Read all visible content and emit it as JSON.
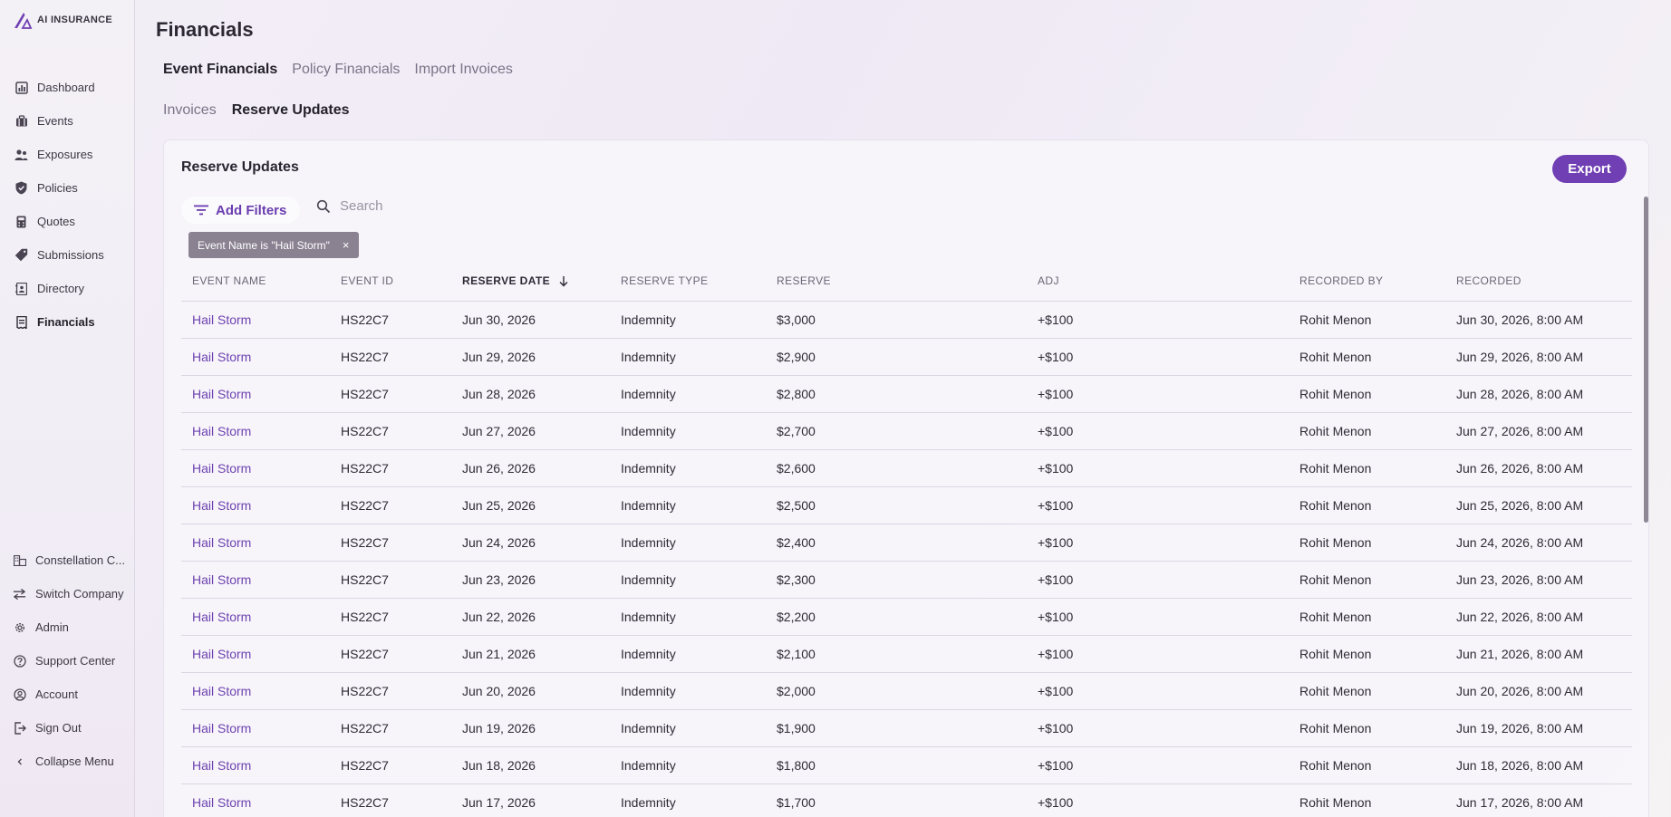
{
  "brand": {
    "name": "AI INSURANCE"
  },
  "sidebar": {
    "items": [
      {
        "label": "Dashboard",
        "icon": "dashboard-icon"
      },
      {
        "label": "Events",
        "icon": "briefcase-icon"
      },
      {
        "label": "Exposures",
        "icon": "people-icon"
      },
      {
        "label": "Policies",
        "icon": "shield-icon"
      },
      {
        "label": "Quotes",
        "icon": "calculator-icon"
      },
      {
        "label": "Submissions",
        "icon": "tag-icon"
      },
      {
        "label": "Directory",
        "icon": "contacts-book-icon"
      },
      {
        "label": "Financials",
        "icon": "receipt-icon",
        "active": true
      }
    ],
    "bottom_items": [
      {
        "label": "Constellation C...",
        "icon": "building-icon"
      },
      {
        "label": "Switch Company",
        "icon": "switch-arrows-icon"
      },
      {
        "label": "Admin",
        "icon": "gear-icon"
      },
      {
        "label": "Support Center",
        "icon": "help-circle-icon"
      },
      {
        "label": "Account",
        "icon": "account-circle-icon"
      },
      {
        "label": "Sign Out",
        "icon": "sign-out-icon"
      },
      {
        "label": "Collapse Menu",
        "icon": "chevron-left-icon"
      }
    ]
  },
  "page": {
    "title": "Financials"
  },
  "tabs_primary": [
    "Event Financials",
    "Policy Financials",
    "Import Invoices"
  ],
  "tabs_secondary": [
    "Invoices",
    "Reserve Updates"
  ],
  "card": {
    "title": "Reserve Updates",
    "export_label": "Export",
    "add_filters_label": "Add Filters",
    "search_placeholder": "Search",
    "filter_chip": "Event Name is \"Hail Storm\"",
    "filter_chip_close": "×"
  },
  "table": {
    "columns": [
      "EVENT NAME",
      "EVENT ID",
      "RESERVE DATE",
      "RESERVE TYPE",
      "RESERVE",
      "ADJ",
      "RECORDED BY",
      "RECORDED"
    ],
    "sorted_column": "RESERVE DATE",
    "rows": [
      [
        "Hail Storm",
        "HS22C7",
        "Jun 30, 2026",
        "Indemnity",
        "$3,000",
        "+$100",
        "Rohit Menon",
        "Jun 30, 2026, 8:00 AM"
      ],
      [
        "Hail Storm",
        "HS22C7",
        "Jun 29, 2026",
        "Indemnity",
        "$2,900",
        "+$100",
        "Rohit Menon",
        "Jun 29, 2026, 8:00 AM"
      ],
      [
        "Hail Storm",
        "HS22C7",
        "Jun 28, 2026",
        "Indemnity",
        "$2,800",
        "+$100",
        "Rohit Menon",
        "Jun 28, 2026, 8:00 AM"
      ],
      [
        "Hail Storm",
        "HS22C7",
        "Jun 27, 2026",
        "Indemnity",
        "$2,700",
        "+$100",
        "Rohit Menon",
        "Jun 27, 2026, 8:00 AM"
      ],
      [
        "Hail Storm",
        "HS22C7",
        "Jun 26, 2026",
        "Indemnity",
        "$2,600",
        "+$100",
        "Rohit Menon",
        "Jun 26, 2026, 8:00 AM"
      ],
      [
        "Hail Storm",
        "HS22C7",
        "Jun 25, 2026",
        "Indemnity",
        "$2,500",
        "+$100",
        "Rohit Menon",
        "Jun 25, 2026, 8:00 AM"
      ],
      [
        "Hail Storm",
        "HS22C7",
        "Jun 24, 2026",
        "Indemnity",
        "$2,400",
        "+$100",
        "Rohit Menon",
        "Jun 24, 2026, 8:00 AM"
      ],
      [
        "Hail Storm",
        "HS22C7",
        "Jun 23, 2026",
        "Indemnity",
        "$2,300",
        "+$100",
        "Rohit Menon",
        "Jun 23, 2026, 8:00 AM"
      ],
      [
        "Hail Storm",
        "HS22C7",
        "Jun 22, 2026",
        "Indemnity",
        "$2,200",
        "+$100",
        "Rohit Menon",
        "Jun 22, 2026, 8:00 AM"
      ],
      [
        "Hail Storm",
        "HS22C7",
        "Jun 21, 2026",
        "Indemnity",
        "$2,100",
        "+$100",
        "Rohit Menon",
        "Jun 21, 2026, 8:00 AM"
      ],
      [
        "Hail Storm",
        "HS22C7",
        "Jun 20, 2026",
        "Indemnity",
        "$2,000",
        "+$100",
        "Rohit Menon",
        "Jun 20, 2026, 8:00 AM"
      ],
      [
        "Hail Storm",
        "HS22C7",
        "Jun 19, 2026",
        "Indemnity",
        "$1,900",
        "+$100",
        "Rohit Menon",
        "Jun 19, 2026, 8:00 AM"
      ],
      [
        "Hail Storm",
        "HS22C7",
        "Jun 18, 2026",
        "Indemnity",
        "$1,800",
        "+$100",
        "Rohit Menon",
        "Jun 18, 2026, 8:00 AM"
      ],
      [
        "Hail Storm",
        "HS22C7",
        "Jun 17, 2026",
        "Indemnity",
        "$1,700",
        "+$100",
        "Rohit Menon",
        "Jun 17, 2026, 8:00 AM"
      ]
    ]
  },
  "colors": {
    "accent": "#6f3fb3",
    "link": "#6d43b0",
    "chip": "#8a8291"
  }
}
